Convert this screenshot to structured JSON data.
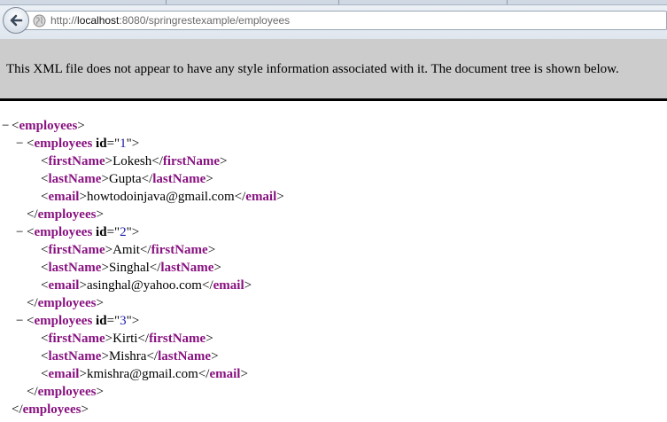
{
  "browser": {
    "url_scheme": "http://",
    "url_host": "localhost",
    "url_rest": ":8080/springrestexample/employees"
  },
  "banner": {
    "text": "This XML file does not appear to have any style information associated with it. The document tree is shown below."
  },
  "xml": {
    "root_tag": "employees",
    "employee_tag": "employees",
    "id_attr": "id",
    "employees": [
      {
        "id": "1",
        "fields": [
          {
            "tag": "firstName",
            "value": "Lokesh"
          },
          {
            "tag": "lastName",
            "value": "Gupta"
          },
          {
            "tag": "email",
            "value": "howtodoinjava@gmail.com"
          }
        ]
      },
      {
        "id": "2",
        "fields": [
          {
            "tag": "firstName",
            "value": "Amit"
          },
          {
            "tag": "lastName",
            "value": "Singhal"
          },
          {
            "tag": "email",
            "value": "asinghal@yahoo.com"
          }
        ]
      },
      {
        "id": "3",
        "fields": [
          {
            "tag": "firstName",
            "value": "Kirti"
          },
          {
            "tag": "lastName",
            "value": "Mishra"
          },
          {
            "tag": "email",
            "value": "kmishra@gmail.com"
          }
        ]
      }
    ]
  }
}
